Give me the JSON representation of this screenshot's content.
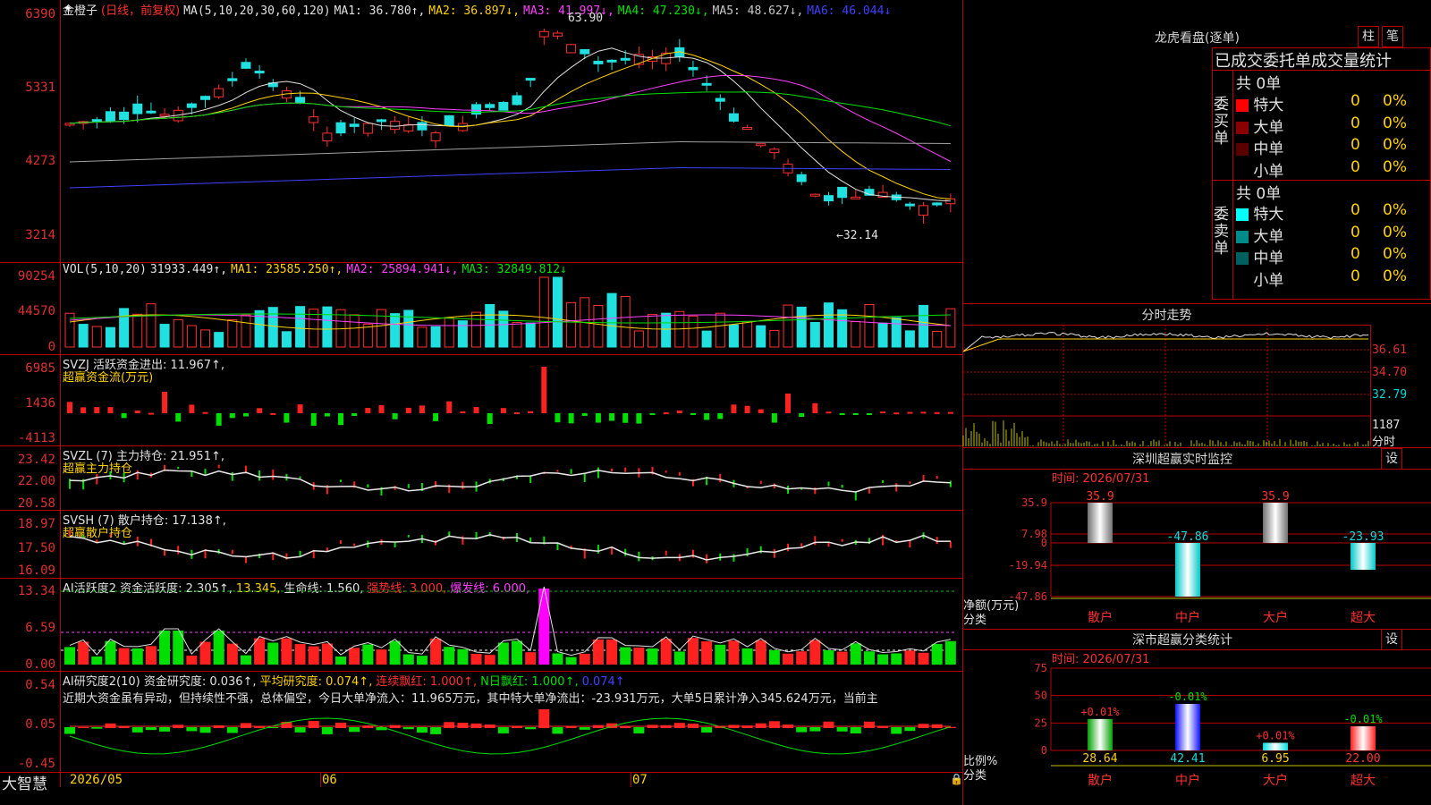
{
  "app": {
    "name": "大智慧"
  },
  "stock": {
    "name": "金橙子",
    "period": "(日线，前复权)"
  },
  "main_chart": {
    "y_labels": [
      "6390",
      "5331",
      "4273",
      "3214"
    ],
    "ma_label": "MA(5,10,20,30,60,120)",
    "ma": [
      {
        "text": "MA1: 36.780↑,",
        "color": "#e0e0e0"
      },
      {
        "text": "MA2: 36.897↓,",
        "color": "#ffd200"
      },
      {
        "text": "MA3: 41.997↓,",
        "color": "#ff40ff"
      },
      {
        "text": "MA4: 47.230↓,",
        "color": "#00e000"
      },
      {
        "text": "MA5: 48.627↓,",
        "color": "#c8c8c8"
      },
      {
        "text": "MA6: 46.044↓",
        "color": "#4040ff"
      }
    ],
    "high_mark": "63.90",
    "low_mark": "←32.14"
  },
  "vol_panel": {
    "y_labels": [
      "90254",
      "44570",
      "0"
    ],
    "label": "VOL(5,10,20)",
    "value": "31933.449↑,",
    "ma1": "MA1: 23585.250↑,",
    "ma2": "MA2: 25894.941↓,",
    "ma3": "MA3: 32849.812↓"
  },
  "svzj": {
    "y_labels": [
      "6985",
      "1436",
      "-4113"
    ],
    "line1": "SVZJ  活跃资金进出: 11.967↑,",
    "line2": "超赢资金流(万元)"
  },
  "svzl": {
    "y_labels": [
      "23.42",
      "22.00",
      "20.58"
    ],
    "line1": "SVZL (7) 主力持仓: 21.951↑,",
    "line2": "超赢主力持仓"
  },
  "svsh": {
    "y_labels": [
      "18.97",
      "17.50",
      "16.09"
    ],
    "line1": "SVSH (7) 散户持仓: 17.138↑,",
    "line2": "超赢散户持仓"
  },
  "ai_active": {
    "y_labels": [
      "13.34",
      "6.59",
      "0.00"
    ],
    "p1": "AI活跃度2 资金活跃度: 2.305↑,",
    "p2": "13.345,",
    "p3": "生命线: 1.560,",
    "p4": "强势线: 3.000,",
    "p5": "爆发线: 6.000,"
  },
  "ai_research": {
    "y_labels": [
      "0.54",
      "0.05",
      "-0.45"
    ],
    "p1": "AI研究度2(10) 资金研究度: 0.036↑,",
    "p2": "平均研究度: 0.074↑,",
    "p3": "连续飘红: 1.000↑,",
    "p4": "N日飘红: 1.000↑,",
    "p5": "0.074↑",
    "comment": "近期大资金虽有异动，但持续性不强，总体偏空，今日大单净流入：11.965万元，其中特大单净流出：-23.931万元，大单5日累计净入345.624万元，当前主"
  },
  "x_axis": {
    "labels": [
      "2026/05",
      "06",
      "07"
    ]
  },
  "chart_data": [
    {
      "type": "bar",
      "title": "深圳超赢实时监控",
      "subtitle": "时间: 2026/07/31",
      "ylabel": "净额(万元)",
      "xlabel": "分类",
      "y_ticks": [
        "35.9",
        "7.98",
        "0",
        "-19.94",
        "-47.86"
      ],
      "categories": [
        "散户",
        "中户",
        "大户",
        "超大"
      ],
      "values": [
        35.9,
        -47.86,
        35.9,
        -23.93
      ],
      "value_labels": [
        "35.9",
        "-47.86",
        "35.9",
        "-23.93"
      ],
      "ylim": [
        -47.86,
        35.9
      ]
    },
    {
      "type": "bar",
      "title": "深市超赢分类统计",
      "subtitle": "时间: 2026/07/31",
      "ylabel": "比例%",
      "xlabel": "分类",
      "y_ticks": [
        "75",
        "50",
        "25",
        "0"
      ],
      "categories": [
        "散户",
        "中户",
        "大户",
        "超大"
      ],
      "values": [
        28.64,
        42.41,
        6.95,
        22.0
      ],
      "value_labels": [
        "28.64",
        "42.41",
        "6.95",
        "22.00"
      ],
      "change_labels": [
        "+0.01%",
        "-0.01%",
        "+0.01%",
        "-0.01%"
      ],
      "ylim": [
        0,
        75
      ]
    }
  ],
  "dragon": {
    "title": "龙虎看盘(逐单)",
    "btn1": "柱",
    "btn2": "笔",
    "subtitle": "已成交委托单成交量统计",
    "buy": {
      "label": "委买单",
      "total": "共 0单",
      "rows": [
        {
          "name": "特大",
          "val": "0",
          "pct": "0%",
          "color": "#ff0000"
        },
        {
          "name": "大单",
          "val": "0",
          "pct": "0%",
          "color": "#8b0000"
        },
        {
          "name": "中单",
          "val": "0",
          "pct": "0%",
          "color": "#5a0000"
        },
        {
          "name": "小单",
          "val": "0",
          "pct": "0%",
          "color": "#000000"
        }
      ]
    },
    "sell": {
      "label": "委卖单",
      "total": "共 0单",
      "rows": [
        {
          "name": "特大",
          "val": "0",
          "pct": "0%",
          "color": "#00ffff"
        },
        {
          "name": "大单",
          "val": "0",
          "pct": "0%",
          "color": "#008b8b"
        },
        {
          "name": "中单",
          "val": "0",
          "pct": "0%",
          "color": "#006060"
        },
        {
          "name": "小单",
          "val": "0",
          "pct": "0%",
          "color": "#000000"
        }
      ]
    }
  },
  "intraday": {
    "title": "分时走势",
    "price_labels": [
      "36.61",
      "34.70",
      "32.79"
    ],
    "vol_labels": [
      "1187",
      "分时"
    ]
  },
  "sz_monitor": {
    "set": "设"
  },
  "sz_class": {
    "set": "设"
  }
}
